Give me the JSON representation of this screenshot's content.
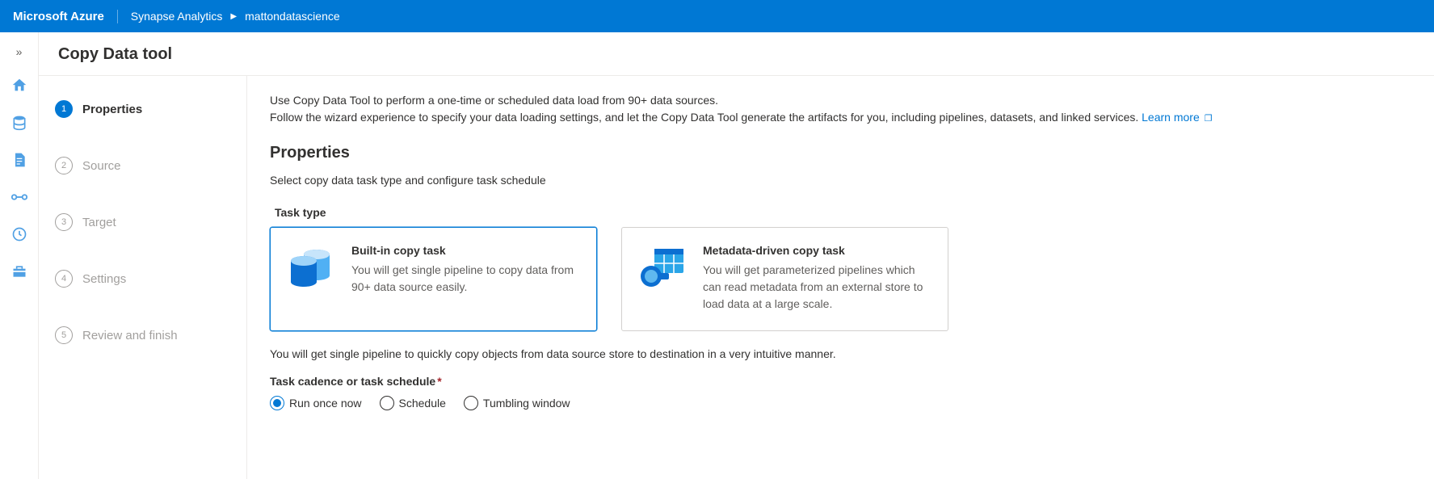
{
  "header": {
    "brand": "Microsoft Azure",
    "breadcrumb": [
      "Synapse Analytics",
      "mattondatascience"
    ]
  },
  "page": {
    "title": "Copy Data tool"
  },
  "wizard": {
    "steps": [
      {
        "num": "1",
        "label": "Properties",
        "active": true
      },
      {
        "num": "2",
        "label": "Source",
        "active": false
      },
      {
        "num": "3",
        "label": "Target",
        "active": false
      },
      {
        "num": "4",
        "label": "Settings",
        "active": false
      },
      {
        "num": "5",
        "label": "Review and finish",
        "active": false
      }
    ]
  },
  "content": {
    "intro1": "Use Copy Data Tool to perform a one-time or scheduled data load from 90+ data sources.",
    "intro2": "Follow the wizard experience to specify your data loading settings, and let the Copy Data Tool generate the artifacts for you, including pipelines, datasets, and linked services. ",
    "learnMore": "Learn more",
    "heading": "Properties",
    "sub": "Select copy data task type and configure task schedule",
    "taskTypeLabel": "Task type",
    "cards": [
      {
        "title": "Built-in copy task",
        "desc": "You will get single pipeline to copy data from 90+ data source easily.",
        "selected": true
      },
      {
        "title": "Metadata-driven copy task",
        "desc": "You will get parameterized pipelines which can read metadata from an external store to load data at a large scale.",
        "selected": false
      }
    ],
    "helper": "You will get single pipeline to quickly copy objects from data source store to destination in a very intuitive manner.",
    "cadenceLabel": "Task cadence or task schedule",
    "radios": [
      {
        "label": "Run once now",
        "selected": true
      },
      {
        "label": "Schedule",
        "selected": false
      },
      {
        "label": "Tumbling window",
        "selected": false
      }
    ]
  }
}
